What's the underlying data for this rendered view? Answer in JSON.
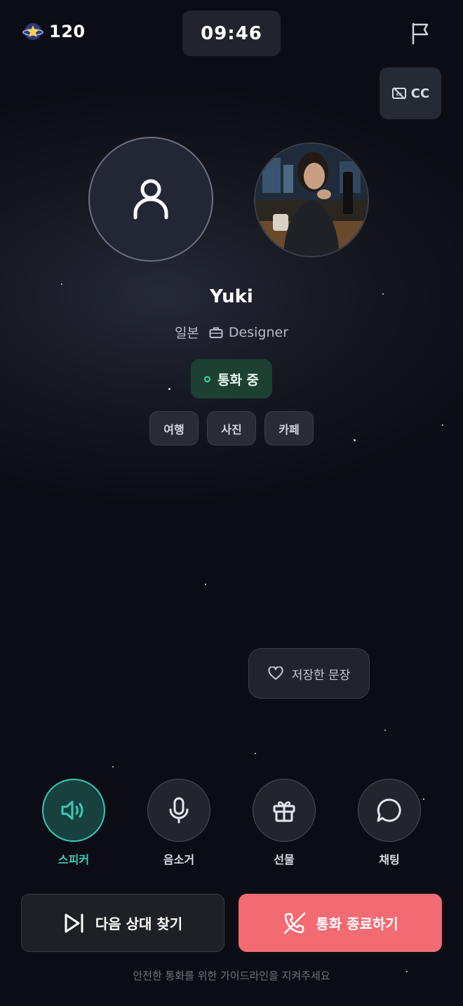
{
  "header": {
    "coins": "120",
    "timer": "09:46",
    "cc_label": "CC"
  },
  "partner": {
    "name": "Yuki",
    "country": "일본",
    "job": "Designer",
    "status": "통화 중",
    "tags": [
      "여행",
      "사진",
      "카페"
    ]
  },
  "saved_sentences_label": "저장한 문장",
  "controls": {
    "speaker": "스피커",
    "mute": "음소거",
    "gift": "선물",
    "chat": "채팅"
  },
  "actions": {
    "next": "다음 상대 찾기",
    "end": "통화 종료하기"
  },
  "guide_text": "안전한 통화를 위한 가이드라인을 지켜주세요",
  "colors": {
    "accent": "#35c7b8",
    "end_call": "#f26b73",
    "status_bg": "#1d4033"
  }
}
